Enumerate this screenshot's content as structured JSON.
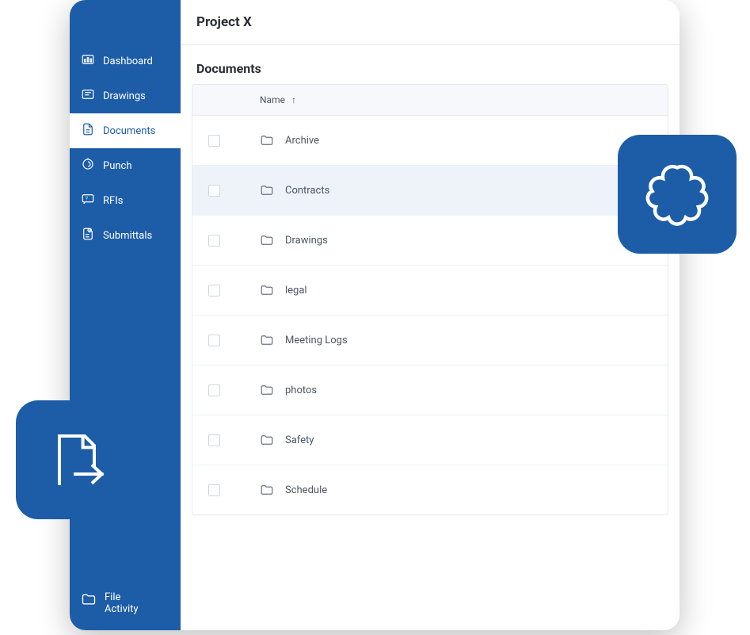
{
  "header": {
    "title": "Project X"
  },
  "section": {
    "title": "Documents"
  },
  "sidebar": {
    "items": [
      {
        "label": "Dashboard"
      },
      {
        "label": "Drawings"
      },
      {
        "label": "Documents"
      },
      {
        "label": "Punch"
      },
      {
        "label": "RFIs"
      },
      {
        "label": "Submittals"
      }
    ],
    "bottom": {
      "label_line1": "File",
      "label_line2": "Activity"
    }
  },
  "table": {
    "columns": {
      "name": "Name",
      "sort_indicator": "↑"
    },
    "rows": [
      {
        "name": "Archive"
      },
      {
        "name": "Contracts"
      },
      {
        "name": "Drawings"
      },
      {
        "name": "legal"
      },
      {
        "name": "Meeting Logs"
      },
      {
        "name": "photos"
      },
      {
        "name": "Safety"
      },
      {
        "name": "Schedule"
      }
    ]
  }
}
